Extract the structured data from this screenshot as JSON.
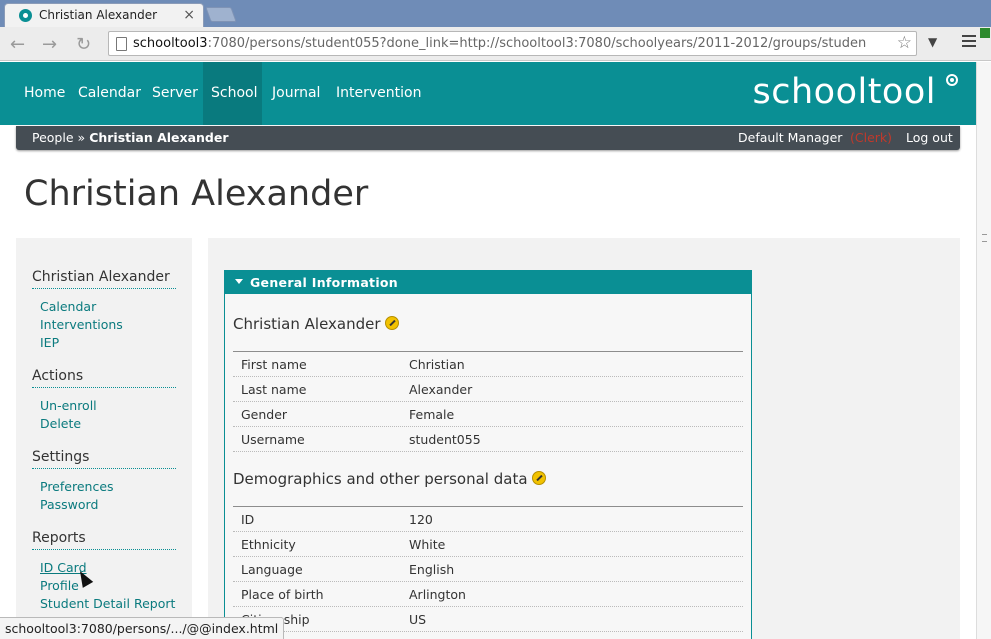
{
  "browser": {
    "tab_title": "Christian Alexander",
    "tab_close": "×",
    "url_host": "schooltool3",
    "url_rest": ":7080/persons/student055?done_link=http://schooltool3:7080/schoolyears/2011-2012/groups/studen",
    "back_icon": "←",
    "forward_icon": "→",
    "reload_icon": "↻",
    "star_icon": "☆",
    "dropdown_icon": "▼"
  },
  "topnav": {
    "items": [
      {
        "label": "Home"
      },
      {
        "label": "Calendar"
      },
      {
        "label": "Server"
      },
      {
        "label": "School"
      },
      {
        "label": "Journal"
      },
      {
        "label": "Intervention"
      }
    ],
    "active": "School",
    "logo": "schooltool"
  },
  "subnav": {
    "crumbs": [
      "People",
      "Christian Alexander"
    ],
    "separator": "»",
    "user": "Default Manager",
    "role": "(Clerk)",
    "logout": "Log out"
  },
  "page_title": "Christian Alexander",
  "sidebar": {
    "sections": [
      {
        "title": "Christian Alexander",
        "links": [
          "Calendar",
          "Interventions",
          "IEP"
        ]
      },
      {
        "title": "Actions",
        "links": [
          "Un-enroll",
          "Delete"
        ]
      },
      {
        "title": "Settings",
        "links": [
          "Preferences",
          "Password"
        ]
      },
      {
        "title": "Reports",
        "links": [
          "ID Card",
          "Profile",
          "Student Detail Report"
        ]
      }
    ]
  },
  "panel": {
    "header": "General Information",
    "person_section": {
      "title": "Christian Alexander",
      "rows": [
        {
          "label": "First name",
          "value": "Christian"
        },
        {
          "label": "Last name",
          "value": "Alexander"
        },
        {
          "label": "Gender",
          "value": "Female"
        },
        {
          "label": "Username",
          "value": "student055"
        }
      ]
    },
    "demographics_section": {
      "title": "Demographics and other personal data",
      "rows": [
        {
          "label": "ID",
          "value": "120"
        },
        {
          "label": "Ethnicity",
          "value": "White"
        },
        {
          "label": "Language",
          "value": "English"
        },
        {
          "label": "Place of birth",
          "value": "Arlington"
        },
        {
          "label": "Citizenship",
          "value": "US"
        }
      ]
    }
  },
  "statusbar": "schooltool3:7080/persons/.../@@index.html",
  "colors": {
    "brand": "#0a8f94",
    "subnav": "#454d54",
    "role": "#c0392b"
  }
}
